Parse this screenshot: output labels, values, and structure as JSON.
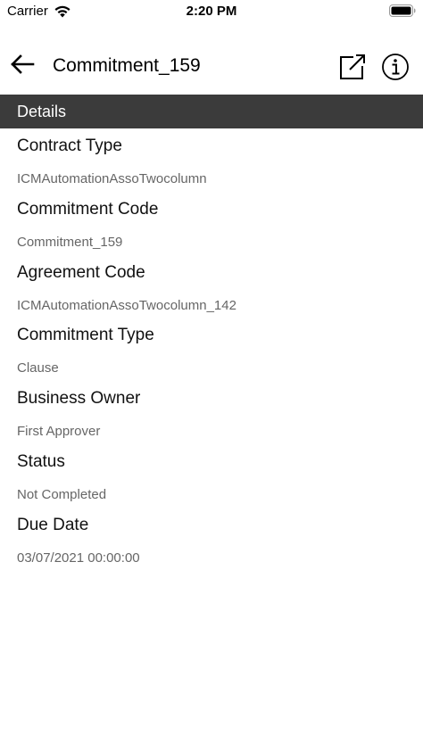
{
  "status_bar": {
    "carrier": "Carrier",
    "time": "2:20 PM"
  },
  "header": {
    "title": "Commitment_159",
    "back_icon": "arrow-left-icon",
    "external_icon": "open-external-icon",
    "info_icon": "info-icon"
  },
  "section": {
    "title": "Details",
    "background": "#3b3b3b"
  },
  "fields": [
    {
      "label": "Contract Type",
      "value": "ICMAutomationAssoTwocolumn"
    },
    {
      "label": "Commitment Code",
      "value": "Commitment_159"
    },
    {
      "label": "Agreement Code",
      "value": "ICMAutomationAssoTwocolumn_142"
    },
    {
      "label": "Commitment Type",
      "value": "Clause"
    },
    {
      "label": "Business Owner",
      "value": "First Approver"
    },
    {
      "label": "Status",
      "value": "Not Completed"
    },
    {
      "label": "Due Date",
      "value": "03/07/2021 00:00:00"
    }
  ]
}
